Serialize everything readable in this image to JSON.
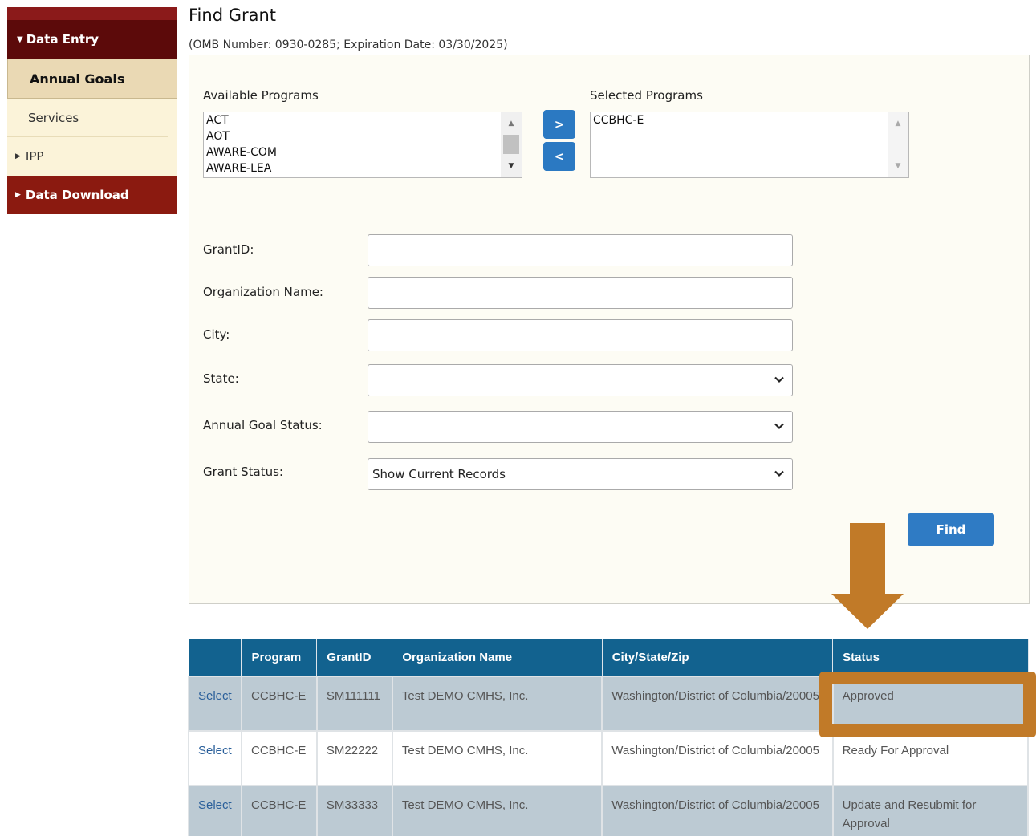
{
  "sidebar": {
    "data_entry": "Data Entry",
    "annual_goals": "Annual Goals",
    "services": "Services",
    "ipp": "IPP",
    "data_download": "Data Download"
  },
  "header": {
    "title": "Find Grant",
    "omb": "(OMB Number: 0930-0285;  Expiration Date: 03/30/2025)"
  },
  "programs": {
    "available_label": "Available Programs",
    "available": [
      "ACT",
      "AOT",
      "AWARE-COM",
      "AWARE-LEA"
    ],
    "selected_label": "Selected Programs",
    "selected": [
      "CCBHC-E"
    ],
    "add_label": ">",
    "remove_label": "<"
  },
  "form": {
    "grantid_label": "GrantID:",
    "grantid_value": "",
    "org_label": "Organization Name:",
    "org_value": "",
    "city_label": "City:",
    "city_value": "",
    "state_label": "State:",
    "state_value": "",
    "annual_status_label": "Annual Goal Status:",
    "annual_status_value": "",
    "grant_status_label": "Grant Status:",
    "grant_status_value": "Show Current Records",
    "find_label": "Find"
  },
  "table": {
    "headers": [
      "",
      "Program",
      "GrantID",
      "Organization Name",
      "City/State/Zip",
      "Status"
    ],
    "rows": [
      {
        "select": "Select",
        "program": "CCBHC-E",
        "grantid": "SM111111",
        "org": "Test DEMO CMHS, Inc.",
        "city": "Washington/District of Columbia/20005",
        "status": "Approved"
      },
      {
        "select": "Select",
        "program": "CCBHC-E",
        "grantid": "SM22222",
        "org": "Test DEMO CMHS, Inc.",
        "city": "Washington/District of Columbia/20005",
        "status": "Ready For Approval"
      },
      {
        "select": "Select",
        "program": "CCBHC-E",
        "grantid": "SM33333",
        "org": "Test DEMO CMHS, Inc.",
        "city": "Washington/District of Columbia/20005",
        "status": "Update and Resubmit for Approval"
      }
    ]
  },
  "colors": {
    "sidebar_dark": "#5c0a0a",
    "sidebar_red": "#8b1a10",
    "table_header": "#12628f",
    "button_blue": "#2f7bc4",
    "annotation": "#c17a28"
  }
}
